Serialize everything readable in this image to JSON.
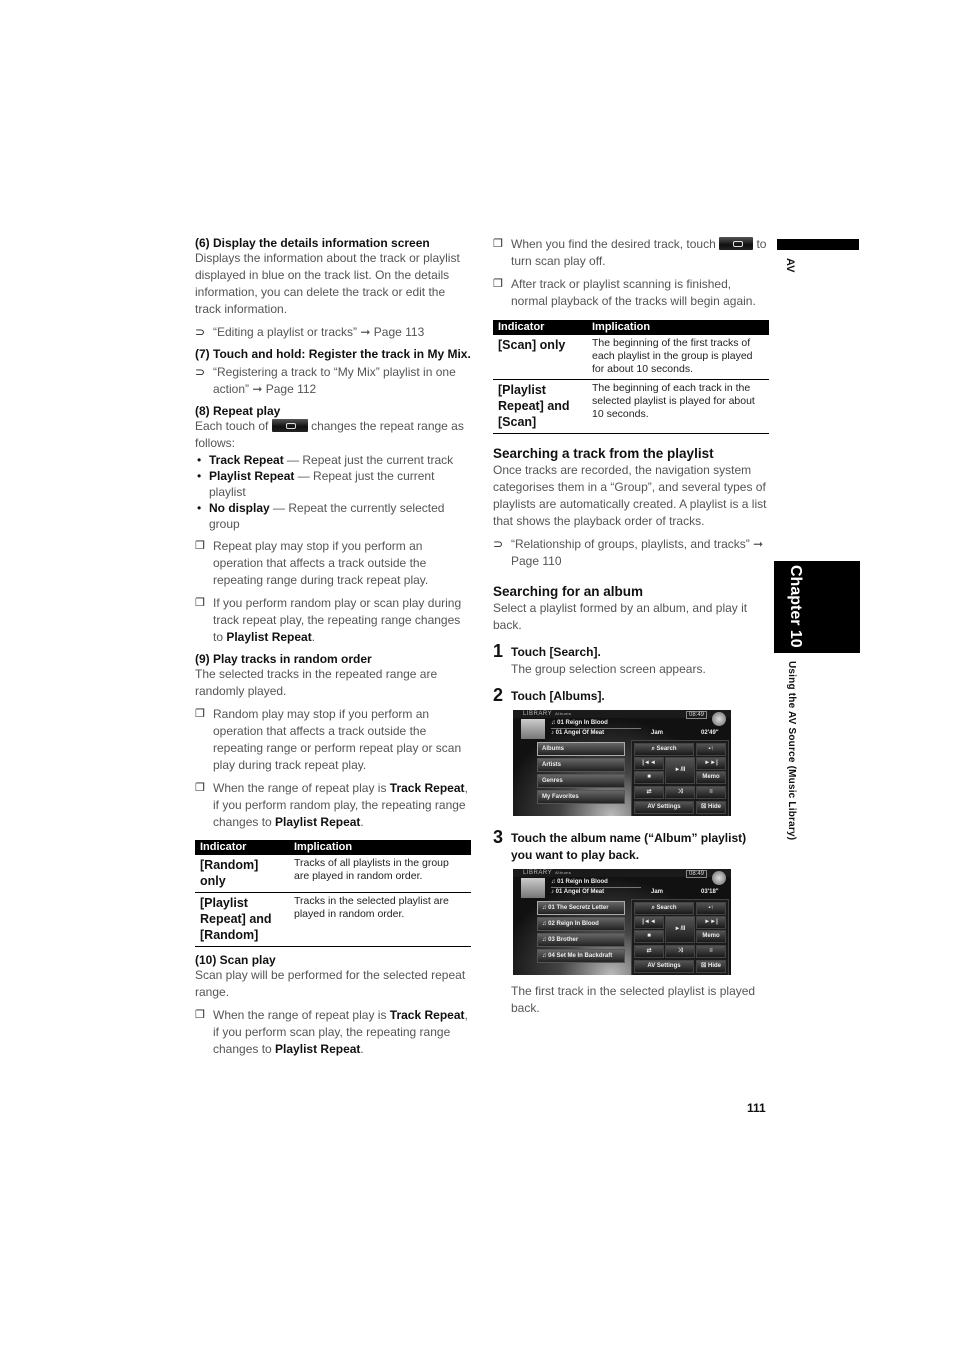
{
  "left": {
    "s6": {
      "heading": "(6) Display the details information screen",
      "body": "Displays the information about the track or playlist displayed in blue on the track list. On the details information, you can delete the track or edit the track information.",
      "ref": "“Editing a playlist or tracks” ➞ Page 113"
    },
    "s7": {
      "heading": "(7) Touch and hold: Register the track in My Mix.",
      "ref": "“Registering a track to “My Mix” playlist in one action” ➞ Page 112"
    },
    "s8": {
      "heading": "(8) Repeat play",
      "intro_pre": "Each touch of",
      "intro_post": "changes the repeat range as follows:",
      "button_icon": "repeat-icon",
      "bullets": [
        {
          "term": "Track Repeat",
          "desc": " — Repeat just the current track"
        },
        {
          "term": "Playlist Repeat",
          "desc": " — Repeat just the current playlist"
        },
        {
          "term": "No display",
          "desc": " — Repeat the currently selected group"
        }
      ],
      "note1": "Repeat play may stop if you perform an operation that affects a track outside the repeating range during track repeat play.",
      "note2_pre": "If you perform random play or scan play during track repeat play, the repeating range changes to ",
      "note2_bold": "Playlist Repeat",
      "note2_post": "."
    },
    "s9": {
      "heading": "(9) Play tracks in random order",
      "body": "The selected tracks in the repeated range are randomly played.",
      "note1": "Random play may stop if you perform an operation that affects a track outside the repeating range or perform repeat play or scan play during track repeat play.",
      "note2_pre": "When the range of repeat play is ",
      "note2_b1": "Track Repeat",
      "note2_mid": ", if you perform random play, the repeating range changes to ",
      "note2_b2": "Playlist Repeat",
      "note2_post": "."
    },
    "table": {
      "headers": [
        "Indicator",
        "Implication"
      ],
      "rows": [
        {
          "indicator": "[Random] only",
          "implication": "Tracks of all playlists in the group are played in random order."
        },
        {
          "indicator": "[Playlist Repeat] and [Random]",
          "implication": "Tracks in the selected playlist are played in random order."
        }
      ]
    },
    "s10": {
      "heading": "(10) Scan play",
      "body": "Scan play will be performed for the selected repeat range.",
      "note_pre": "When the range of repeat play is ",
      "note_b1": "Track Repeat",
      "note_mid": ", if you perform scan play, the repeating range changes to ",
      "note_b2": "Playlist Repeat",
      "note_post": "."
    }
  },
  "right": {
    "note1_pre": "When you find the desired track, touch",
    "note1_post": "to turn scan play off.",
    "note1_icon": "scan-icon",
    "note2": "After track or playlist scanning is finished, normal playback of the tracks will begin again.",
    "table": {
      "headers": [
        "Indicator",
        "Implication"
      ],
      "rows": [
        {
          "indicator": "[Scan] only",
          "implication": "The beginning of the first tracks of each playlist in the group is played for about 10 seconds."
        },
        {
          "indicator": "[Playlist Repeat] and [Scan]",
          "implication": "The beginning of each track in the selected playlist is played for about 10 seconds."
        }
      ]
    },
    "search_track": {
      "heading": "Searching a track from the playlist",
      "body": "Once tracks are recorded, the navigation system categorises them in a “Group”, and several types of playlists are automatically created. A playlist is a list that shows the playback order of tracks.",
      "ref": "“Relationship of groups, playlists, and tracks” ➞ Page 110"
    },
    "search_album": {
      "heading": "Searching for an album",
      "body": "Select a playlist formed by an album, and play it back.",
      "steps": [
        {
          "num": "1",
          "label": "Touch [Search].",
          "desc": "The group selection screen appears."
        },
        {
          "num": "2",
          "label": "Touch [Albums].",
          "desc": ""
        },
        {
          "num": "3",
          "label": "Touch the album name (“Album” playlist) you want to play back.",
          "desc": "The first track in the selected playlist is played back."
        }
      ]
    },
    "screen1": {
      "header": "LIBRARY",
      "sub": "Albums",
      "clock": "08:49",
      "line1": "01 Reign In Blood",
      "line2": "01 Angel Of Meat",
      "artist": "Jam",
      "time": "02'49\"",
      "list": [
        "Albums",
        "Artists",
        "Genres",
        "My Favorites"
      ],
      "buttons": {
        "search": "Search",
        "play": "►/II",
        "memo": "Memo",
        "av": "AV Settings",
        "hide": "Hide"
      }
    },
    "screen2": {
      "header": "LIBRARY",
      "sub": "Albums",
      "clock": "08:49",
      "line1": "01 Reign In Blood",
      "line2": "01 Angel Of Meat",
      "artist": "Jam",
      "time": "03'18\"",
      "list": [
        "01 The Secretz Letter",
        "02 Reign In Blood",
        "03 Brother",
        "04 Set Me In Backdraft"
      ],
      "buttons": {
        "search": "Search",
        "play": "►/II",
        "memo": "Memo",
        "av": "AV Settings",
        "hide": "Hide"
      }
    }
  },
  "side": {
    "section": "AV",
    "chapter": "Chapter 10",
    "title": "Using the AV Source (Music Library)"
  },
  "page_number": "111"
}
